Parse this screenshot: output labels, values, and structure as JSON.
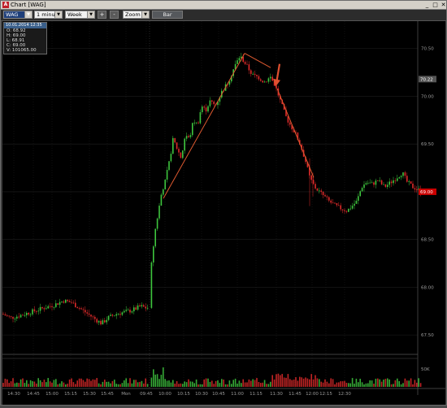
{
  "window": {
    "title": "Chart [WAG]",
    "minimize": "_",
    "maximize": "□",
    "close": "✕"
  },
  "toolbar": {
    "symbol": "WAG",
    "interval": "1 minute",
    "range": "Week",
    "zoom_in": "+",
    "zoom_out": "-",
    "zoom": "Zoom",
    "bar": "Bar"
  },
  "info_box": {
    "header": "10.01.2014 12:35",
    "rows": [
      "O: 68.92",
      "H: 69.00",
      "L: 68.91",
      "C: 69.00",
      "V: 101065.00"
    ]
  },
  "chart_data": {
    "type": "candlestick",
    "symbol": "WAG",
    "interval": "1 minute",
    "y_tick_labels": [
      "70.50",
      "70.00",
      "69.50",
      "69.00",
      "68.50",
      "68.00",
      "67.50"
    ],
    "x_tick_labels": [
      "14:30",
      "14:45",
      "15:00",
      "15:15",
      "15:30",
      "15:45",
      "Mon",
      "09:45",
      "10:00",
      "10:15",
      "10:30",
      "10:45",
      "11:00",
      "11:15",
      "11:30",
      "11:45",
      "12:00",
      "12:15",
      "12:30"
    ],
    "ylim": [
      67.45,
      70.6
    ],
    "volume_axis_label": "50K",
    "price_markers": [
      {
        "text": "70.22",
        "value": 70.18,
        "color": "#555555"
      },
      {
        "text": "69.00",
        "value": 69.0,
        "color": "#cc0000"
      }
    ],
    "price_path": [
      [
        0,
        67.72
      ],
      [
        10,
        67.68
      ],
      [
        20,
        67.7
      ],
      [
        35,
        67.74
      ],
      [
        50,
        67.78
      ],
      [
        65,
        67.82
      ],
      [
        75,
        67.86
      ],
      [
        85,
        67.84
      ],
      [
        95,
        67.78
      ],
      [
        105,
        67.72
      ],
      [
        115,
        67.66
      ],
      [
        122,
        67.62
      ],
      [
        130,
        67.68
      ],
      [
        140,
        67.72
      ],
      [
        150,
        67.74
      ],
      [
        160,
        67.76
      ],
      [
        170,
        67.8
      ],
      [
        178,
        67.78
      ],
      [
        180,
        67.8
      ],
      [
        181,
        68.0
      ],
      [
        184,
        68.3
      ],
      [
        188,
        68.6
      ],
      [
        192,
        68.8
      ],
      [
        196,
        69.0
      ],
      [
        200,
        69.1
      ],
      [
        205,
        69.3
      ],
      [
        210,
        69.55
      ],
      [
        215,
        69.45
      ],
      [
        220,
        69.35
      ],
      [
        225,
        69.6
      ],
      [
        230,
        69.55
      ],
      [
        235,
        69.75
      ],
      [
        240,
        69.7
      ],
      [
        245,
        69.9
      ],
      [
        250,
        69.85
      ],
      [
        255,
        69.95
      ],
      [
        262,
        69.9
      ],
      [
        270,
        70.05
      ],
      [
        278,
        70.15
      ],
      [
        285,
        70.3
      ],
      [
        292,
        70.42
      ],
      [
        296,
        70.38
      ],
      [
        302,
        70.3
      ],
      [
        308,
        70.22
      ],
      [
        315,
        70.2
      ],
      [
        322,
        70.15
      ],
      [
        330,
        70.2
      ],
      [
        336,
        70.1
      ],
      [
        342,
        69.95
      ],
      [
        348,
        69.8
      ],
      [
        354,
        69.7
      ],
      [
        360,
        69.62
      ],
      [
        366,
        69.5
      ],
      [
        372,
        69.35
      ],
      [
        378,
        69.15
      ],
      [
        384,
        69.05
      ],
      [
        390,
        69.0
      ],
      [
        396,
        68.95
      ],
      [
        402,
        68.9
      ],
      [
        410,
        68.85
      ],
      [
        418,
        68.82
      ],
      [
        424,
        68.8
      ],
      [
        430,
        68.85
      ],
      [
        436,
        68.9
      ],
      [
        442,
        69.05
      ],
      [
        448,
        69.1
      ],
      [
        455,
        69.08
      ],
      [
        462,
        69.12
      ],
      [
        470,
        69.05
      ],
      [
        478,
        69.1
      ],
      [
        485,
        69.15
      ],
      [
        492,
        69.2
      ],
      [
        498,
        69.1
      ],
      [
        505,
        69.05
      ],
      [
        512,
        69.02
      ],
      [
        515,
        69.0
      ]
    ],
    "trendlines": [
      {
        "x1": 198,
        "y1": 68.93,
        "x2": 298,
        "y2": 70.45
      },
      {
        "x1": 298,
        "y1": 70.45,
        "x2": 330,
        "y2": 70.3
      },
      {
        "x1": 338,
        "y1": 70.08,
        "x2": 383,
        "y2": 69.15
      }
    ],
    "arrow": {
      "x": 338,
      "y": 70.1,
      "color": "#e05030"
    }
  }
}
